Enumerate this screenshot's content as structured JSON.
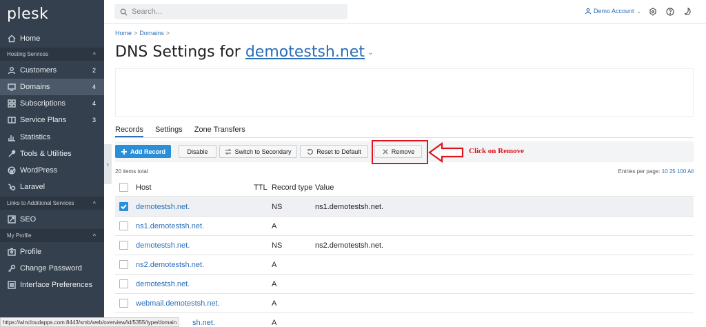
{
  "sidebar": {
    "logo": "plesk",
    "home": "Home",
    "hosting_section": "Hosting Services",
    "customers": "Customers",
    "customers_count": "2",
    "domains": "Domains",
    "domains_count": "4",
    "subscriptions": "Subscriptions",
    "subscriptions_count": "4",
    "service_plans": "Service Plans",
    "service_plans_count": "3",
    "statistics": "Statistics",
    "tools": "Tools & Utilities",
    "wordpress": "WordPress",
    "laravel": "Laravel",
    "links_section": "Links to Additional Services",
    "seo": "SEO",
    "profile_section": "My Profile",
    "profile": "Profile",
    "change_password": "Change Password",
    "interface_prefs": "Interface Preferences"
  },
  "topbar": {
    "search_placeholder": "Search...",
    "account": "Demo Account"
  },
  "breadcrumb": {
    "home": "Home",
    "domains": "Domains"
  },
  "page": {
    "title_prefix": "DNS Settings for ",
    "domain": "demotestsh.net"
  },
  "tabs": [
    "Records",
    "Settings",
    "Zone Transfers"
  ],
  "toolbar": {
    "add_record": "Add Record",
    "disable": "Disable",
    "switch_secondary": "Switch to Secondary",
    "reset_default": "Reset to Default",
    "remove": "Remove"
  },
  "annotation": {
    "callout": "Click on Remove",
    "color": "#e0141c"
  },
  "list": {
    "items_total": "20 items total",
    "entries_label": "Entries per page:",
    "entries_options": [
      "10",
      "25",
      "100",
      "All"
    ]
  },
  "table": {
    "columns": [
      "Host",
      "TTL",
      "Record type",
      "Value"
    ],
    "rows": [
      {
        "host": "demotestsh.net.",
        "type": "NS",
        "value": "ns1.demotestsh.net.",
        "checked": true
      },
      {
        "host": "ns1.demotestsh.net.",
        "type": "A",
        "value": "",
        "checked": false
      },
      {
        "host": "demotestsh.net.",
        "type": "NS",
        "value": "ns2.demotestsh.net.",
        "checked": false
      },
      {
        "host": "ns2.demotestsh.net.",
        "type": "A",
        "value": "",
        "checked": false
      },
      {
        "host": "demotestsh.net.",
        "type": "A",
        "value": "",
        "checked": false
      },
      {
        "host": "webmail.demotestsh.net.",
        "type": "A",
        "value": "",
        "checked": false
      },
      {
        "host": "sh.net.",
        "type": "A",
        "value": "",
        "checked": false
      }
    ]
  },
  "statusbar": {
    "url": "https://wincloudapps.com:8443/smb/web/overview/id/5355/type/domain"
  }
}
